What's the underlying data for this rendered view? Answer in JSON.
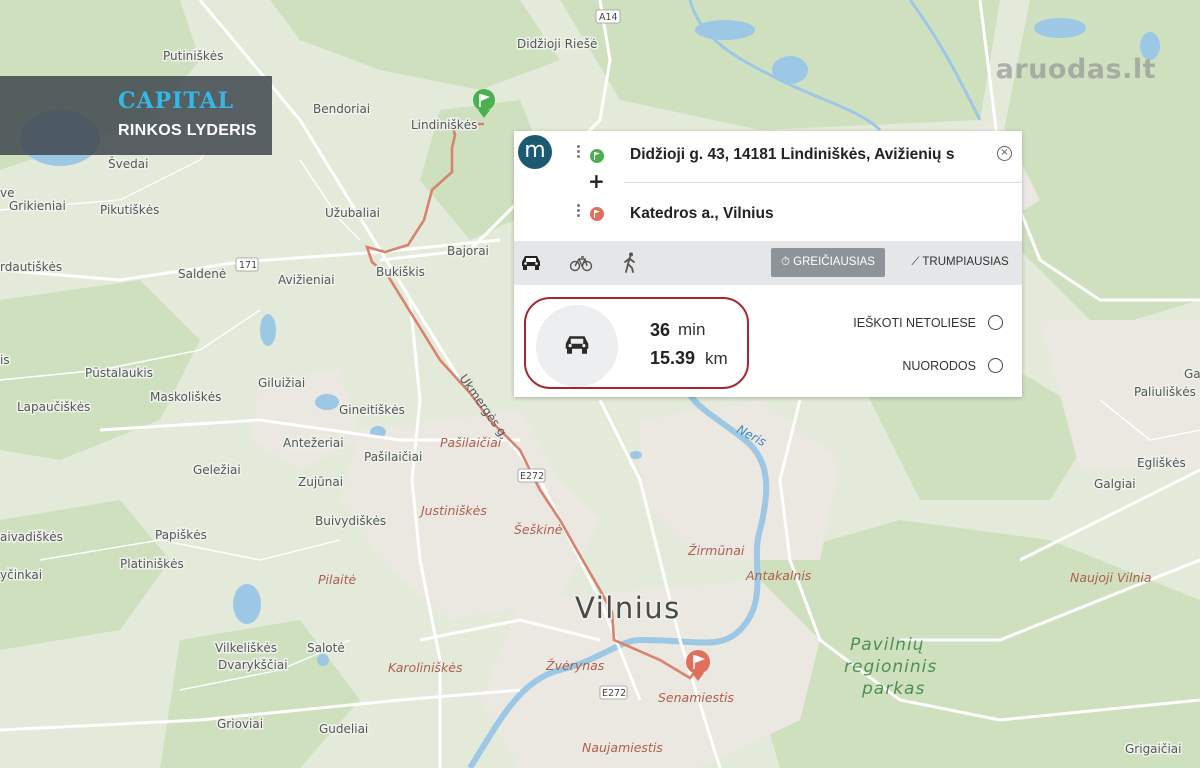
{
  "map": {
    "city": "Vilnius",
    "park_line1": "Pavilnių",
    "park_line2": "regioninis",
    "park_line3": "parkas",
    "places": [
      "Putiniškės",
      "Didžioji Riešė",
      "Bendoriai",
      "Lindiniškės",
      "Švedai",
      "Grikieniai",
      "Pikutiškės",
      "Užubaliai",
      "Bajorai",
      "Saldenė",
      "Avižieniai",
      "Bukiškis",
      "rdautiškės",
      "Pūstalaukis",
      "Giluižiai",
      "Lapaučiškės",
      "Maskoliškės",
      "Gineitiškės",
      "Antežeriai",
      "Pašilaičiai",
      "Geležiai",
      "Zujūnai",
      "Buivydiškės",
      "Papiškės",
      "Platiniškės",
      "aivadiškės",
      "yčinkai",
      "Vilkeliškės",
      "Salotė",
      "Dvarykščiai",
      "Grioviai",
      "Gudeliai",
      "Galgiai",
      "Egliškės",
      "Paliuliškės",
      "Grigaičiai",
      "ve",
      "is",
      "Ga"
    ],
    "districts": [
      "Pašilaičiai",
      "Justiniškės",
      "Šeškinė",
      "Pilaitė",
      "Karoliniškės",
      "Žvėrynas",
      "Senamiestis",
      "Naujamiestis",
      "Žirmūnai",
      "Antakalnis",
      "Naujoji Vilnia"
    ],
    "river": "Neris",
    "road_name": "Ukmergės g.",
    "shields": [
      "A14",
      "171",
      "E272",
      "E272"
    ]
  },
  "badge": {
    "brand": "CAPITAL",
    "slogan": "RINKOS LYDERIS"
  },
  "watermark": "aruodas.lt",
  "panel": {
    "logo_letter": "m",
    "from": "Didžioji g. 43, 14181 Lindiniškės, Avižienių s",
    "to": "Katedros a., Vilnius",
    "add_stop": "+",
    "clear": "×",
    "modes": [
      "car-icon",
      "bicycle-icon",
      "walk-icon"
    ],
    "fastest_label": "⏱ GREIČIAUSIAS",
    "shortest_label": "⟋ TRUMPIAUSIAS",
    "result": {
      "time_value": "36",
      "time_unit": "min",
      "distance_value": "15.39",
      "distance_unit": "km"
    },
    "actions": {
      "nearby": "IEŠKOTI NETOLIESE",
      "links": "NUORODOS"
    }
  },
  "colors": {
    "route": "#d9826c",
    "accent_logo": "#1b5a70",
    "highlight": "#a8252f",
    "start_pin": "#4caf50",
    "end_pin": "#e0705e"
  }
}
